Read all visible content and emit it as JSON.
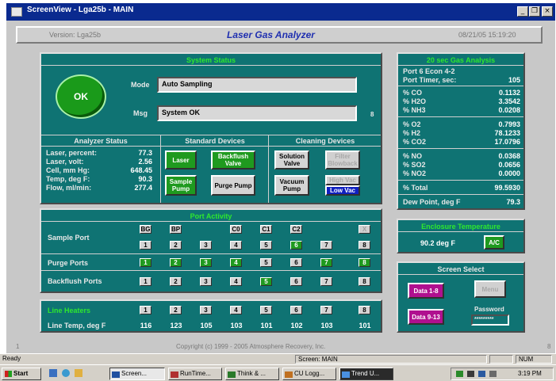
{
  "window": {
    "title": "ScreenView - Lga25b - MAIN"
  },
  "header": {
    "version": "Version: Lga25b",
    "app_title": "Laser Gas Analyzer",
    "datetime": "08/21/05  15:19:20"
  },
  "system_status": {
    "title": "System Status",
    "ok_label": "OK",
    "mode_label": "Mode",
    "mode_value": "Auto Sampling",
    "msg_label": "Msg",
    "msg_value": "System OK",
    "msg_suffix": "8"
  },
  "analyzer_status": {
    "title": "Analyzer Status",
    "rows": [
      {
        "label": "Laser, percent:",
        "value": "77.3"
      },
      {
        "label": "Laser, volt:",
        "value": "2.56"
      },
      {
        "label": "Cell, mm Hg:",
        "value": "648.45"
      },
      {
        "label": "Temp, deg F:",
        "value": "90.3"
      },
      {
        "label": "Flow, ml/min:",
        "value": "277.4"
      }
    ]
  },
  "standard_devices": {
    "title": "Standard Devices",
    "laser": "Laser",
    "backflush_valve": "Backflush Valve",
    "sample_pump": "Sample Pump",
    "purge_pump": "Purge Pump"
  },
  "cleaning_devices": {
    "title": "Cleaning Devices",
    "solution_valve": "Solution Valve",
    "filter_blowback": "Filter Blowback",
    "vacuum_pump": "Vacuum Pump",
    "high_vac": "High Vac",
    "low_vac": "Low Vac"
  },
  "port_activity": {
    "title": "Port Activity",
    "sample_port_label": "Sample Port",
    "purge_ports_label": "Purge Ports",
    "backflush_ports_label": "Backflush Ports",
    "top_labels": [
      "BG",
      "BP",
      "",
      "C0",
      "C1",
      "C2",
      "",
      "X"
    ],
    "numbers": [
      "1",
      "2",
      "3",
      "4",
      "5",
      "6",
      "7",
      "8"
    ]
  },
  "line_heaters": {
    "title": "Line Heaters",
    "temp_label": "Line Temp, deg F",
    "numbers": [
      "1",
      "2",
      "3",
      "4",
      "5",
      "6",
      "7",
      "8"
    ],
    "temps": [
      "116",
      "123",
      "105",
      "103",
      "101",
      "102",
      "103",
      "101"
    ]
  },
  "gas_analysis": {
    "title": "20 sec Gas Analysis",
    "port_line": "Port   6  Econ 4-2",
    "port_timer_label": "Port Timer, sec:",
    "port_timer_value": "105",
    "groups": [
      [
        {
          "label": "% CO",
          "value": "0.1132"
        },
        {
          "label": "% H2O",
          "value": "3.3542"
        },
        {
          "label": "% NH3",
          "value": "0.0208"
        }
      ],
      [
        {
          "label": "% O2",
          "value": "0.7993"
        },
        {
          "label": "% H2",
          "value": "78.1233"
        },
        {
          "label": "% CO2",
          "value": "17.0796"
        }
      ],
      [
        {
          "label": "% NO",
          "value": "0.0368"
        },
        {
          "label": "% SO2",
          "value": "0.0656"
        },
        {
          "label": "% NO2",
          "value": "0.0000"
        }
      ]
    ],
    "total_label": "% Total",
    "total_value": "99.5930",
    "dew_label": "Dew Point, deg F",
    "dew_value": "79.3"
  },
  "enclosure": {
    "title": "Enclosure Temperature",
    "value": "90.2  deg F",
    "ac_label": "A/C"
  },
  "screen_select": {
    "title": "Screen Select",
    "data1": "Data 1-8",
    "data2": "Data 9-13",
    "menu": "Menu",
    "password_label": "Password",
    "password_value": "*********"
  },
  "footer": {
    "copyright": "Copyright  (c)  1999 - 2005  Atmosphere Recovery, Inc.",
    "left_num": "1",
    "right_num": "8"
  },
  "statusbar": {
    "ready": "Ready",
    "screen": "Screen: MAIN",
    "num": "NUM"
  },
  "taskbar": {
    "start": "Start",
    "tasks": [
      "Screen...",
      "RunTime...",
      "Think & ...",
      "CU Logg...",
      "Trend U..."
    ],
    "clock": "3:19 PM"
  },
  "colors": {
    "panel": "#0f7373",
    "green_title": "#2ee82e",
    "button_green": "#1f9a1f",
    "magenta": "#b0108f",
    "title_blue": "#0a2a8f"
  }
}
